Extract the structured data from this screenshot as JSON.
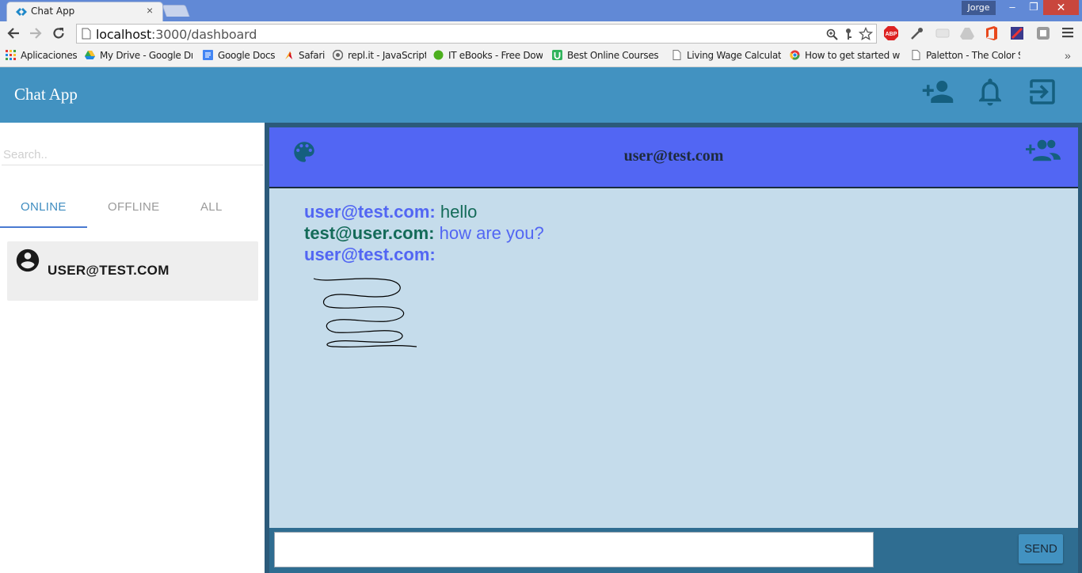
{
  "browser": {
    "tab_title": "Chat App",
    "tab_close": "×",
    "profile_name": "Jorge",
    "window_controls": {
      "minimize": "–",
      "maximize": "❐",
      "close": "✕"
    },
    "url_host": "localhost",
    "url_path": ":3000/dashboard",
    "bookmarks": [
      {
        "label": "Aplicaciones",
        "icon": "apps-grid-icon"
      },
      {
        "label": "My Drive - Google Dri",
        "icon": "google-drive-icon"
      },
      {
        "label": "Google Docs",
        "icon": "google-docs-icon"
      },
      {
        "label": "Safari",
        "icon": "safari-icon"
      },
      {
        "label": "repl.it - JavaScript",
        "icon": "replit-icon"
      },
      {
        "label": "IT eBooks - Free Dow",
        "icon": "green-dot-icon"
      },
      {
        "label": "Best Online Courses |",
        "icon": "udemy-icon"
      },
      {
        "label": "Living Wage Calculato",
        "icon": "page-icon"
      },
      {
        "label": "How to get started wi",
        "icon": "chrome-icon"
      },
      {
        "label": "Paletton - The Color S",
        "icon": "page-icon"
      }
    ],
    "more_bookmarks": "»"
  },
  "app": {
    "title": "Chat App",
    "icons": {
      "add_friend": "person-add-icon",
      "notifications": "bell-icon",
      "logout": "exit-icon"
    }
  },
  "sidebar": {
    "search_placeholder": "Search..",
    "tabs": [
      {
        "label": "ONLINE",
        "active": true
      },
      {
        "label": "OFFLINE",
        "active": false
      },
      {
        "label": "ALL",
        "active": false
      }
    ],
    "contacts": [
      {
        "name": "user@test.com",
        "icon": "account-circle-icon"
      }
    ]
  },
  "chat": {
    "title": "user@test.com",
    "messages": [
      {
        "sender": "user@test.com:",
        "text": "hello",
        "sender_color": "blue",
        "text_color": "green"
      },
      {
        "sender": "test@user.com:",
        "text": "how are you?",
        "sender_color": "green",
        "text_color": "blue"
      },
      {
        "sender": "user@test.com:",
        "text": "",
        "sender_color": "blue",
        "attachment": "drawing"
      }
    ],
    "message_input_value": "",
    "send_label": "SEND"
  },
  "colors": {
    "appbar": "#4292c1",
    "chat_header": "#5266f3",
    "chat_body": "#c5dceb",
    "composer": "#2f6d91",
    "blue_text": "#5266f3",
    "green_text": "#146b59"
  }
}
